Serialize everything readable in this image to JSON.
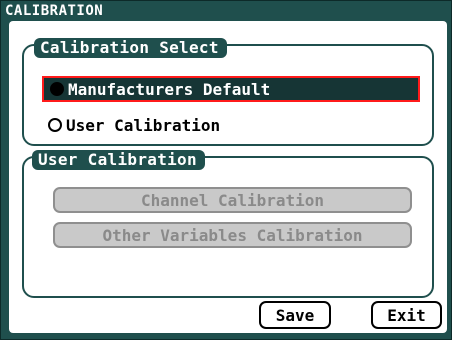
{
  "window": {
    "title": "CALIBRATION"
  },
  "calibration_select": {
    "legend": "Calibration Select",
    "options": [
      {
        "label": "Manufacturers Default",
        "selected": true
      },
      {
        "label": "User Calibration",
        "selected": false
      }
    ]
  },
  "user_calibration": {
    "legend": "User Calibration",
    "buttons": [
      {
        "label": "Channel Calibration",
        "enabled": false
      },
      {
        "label": "Other Variables Calibration",
        "enabled": false
      }
    ]
  },
  "actions": {
    "save": "Save",
    "exit": "Exit"
  },
  "colors": {
    "frame": "#1f4f4d",
    "selected_bg": "#163535",
    "selected_border": "#ff1b1b",
    "disabled_bg": "#c9c9c9",
    "disabled_text": "#8a8a8a"
  }
}
